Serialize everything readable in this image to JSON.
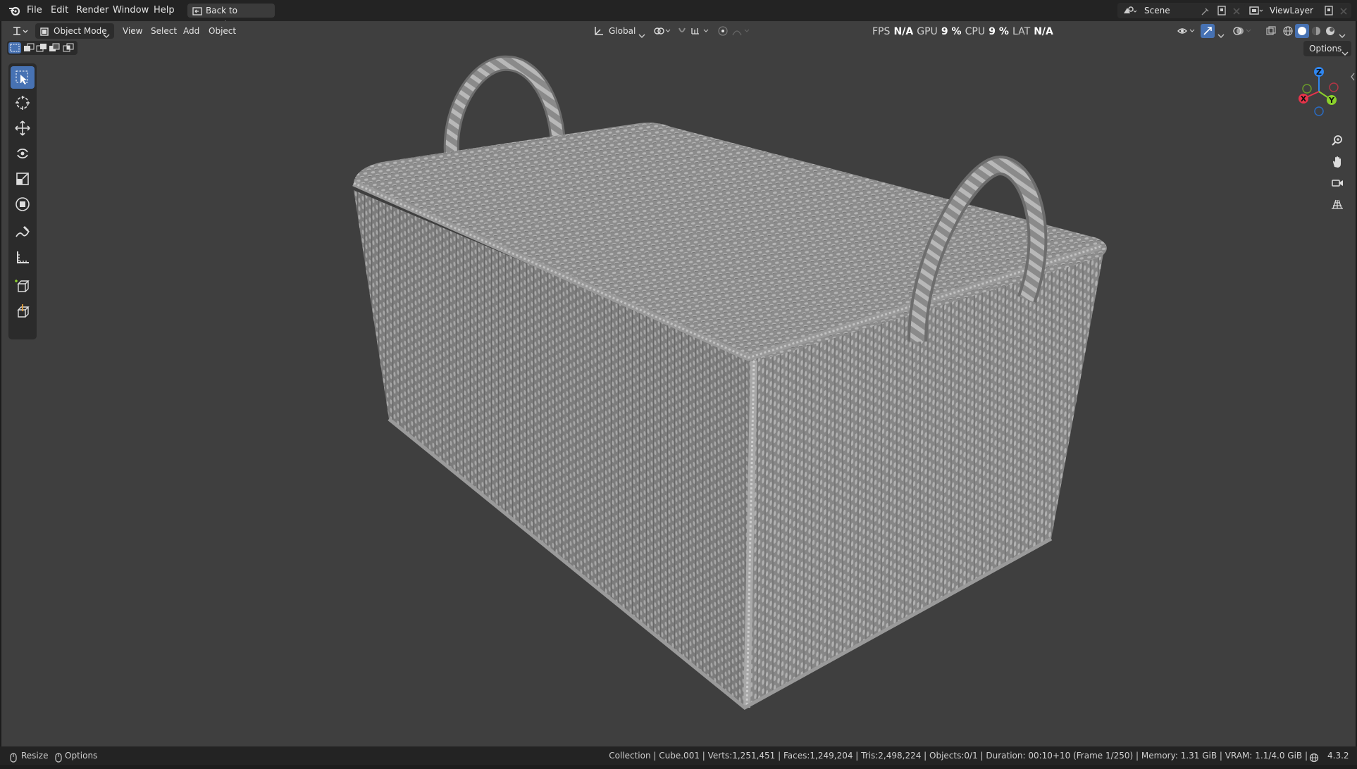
{
  "menu": {
    "file": "File",
    "edit": "Edit",
    "render": "Render",
    "window": "Window",
    "help": "Help",
    "back_to_previous": "Back to Previous"
  },
  "scene": {
    "name": "Scene",
    "view_layer": "ViewLayer"
  },
  "viewport_header": {
    "mode": "Object Mode",
    "view": "View",
    "select": "Select",
    "add": "Add",
    "object": "Object",
    "transform_orientation": "Global",
    "options": "Options"
  },
  "perf": {
    "fps_label": "FPS",
    "fps_value": "N/A",
    "gpu_label": "GPU",
    "gpu_value": "9 %",
    "cpu_label": "CPU",
    "cpu_value": "9 %",
    "lat_label": "LAT",
    "lat_value": "N/A"
  },
  "gizmo": {
    "x": "X",
    "y": "Y",
    "z": "Z"
  },
  "statusbar": {
    "resize": "Resize",
    "options": "Options",
    "info": "Collection | Cube.001 | Verts:1,251,451 | Faces:1,249,204 | Tris:2,498,224 | Objects:0/1 | Duration: 00:10+10 (Frame 1/250) | Memory: 1.31 GiB | VRAM: 1.1/4.0 GiB |",
    "version": "4.3.2"
  },
  "colors": {
    "viewport_bg": "#3f3f3f",
    "active_tool": "#4772b3",
    "axis_x": "#e8344a",
    "axis_y": "#8bd12b",
    "axis_z": "#2f86f0"
  },
  "icons": {
    "app": "blender-logo-icon",
    "tools": [
      "select-box-icon",
      "cursor-icon",
      "move-icon",
      "rotate-icon",
      "scale-icon",
      "transform-icon",
      "annotate-icon",
      "measure-icon",
      "add-cube-icon",
      "extrude-icon"
    ],
    "nav": [
      "zoom-icon",
      "pan-hand-icon",
      "camera-view-icon",
      "ortho-grid-icon"
    ]
  }
}
